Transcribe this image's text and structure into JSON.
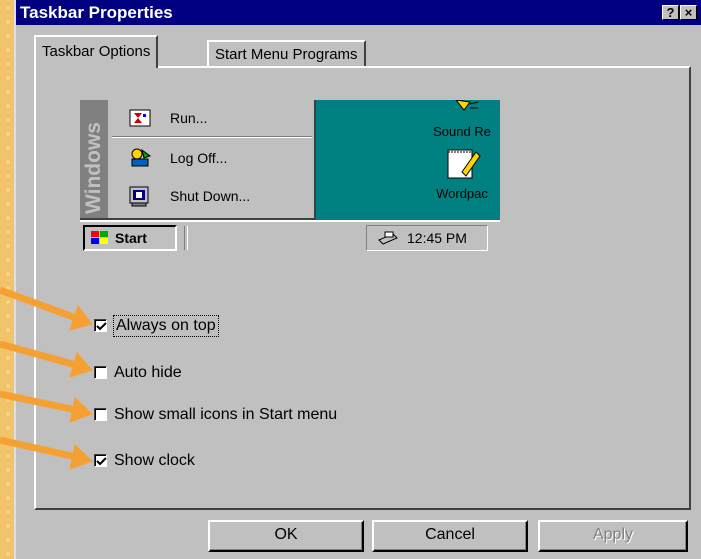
{
  "window": {
    "title": "Taskbar Properties",
    "help_label": "?",
    "close_label": "×"
  },
  "tabs": [
    {
      "label": "Taskbar Options",
      "active": true
    },
    {
      "label": "Start Menu Programs",
      "active": false
    }
  ],
  "preview": {
    "band_text": "Windows",
    "menu_items": [
      {
        "label": "Run...",
        "icon": "run-icon"
      },
      {
        "label": "Log Off...",
        "icon": "logoff-icon"
      },
      {
        "label": "Shut Down...",
        "icon": "shutdown-icon"
      }
    ],
    "desktop_icons": [
      {
        "label": "Sound Re",
        "icon": "sound-recorder-icon"
      },
      {
        "label": "Wordpac",
        "icon": "wordpad-icon"
      }
    ],
    "start_label": "Start",
    "clock": "12:45 PM"
  },
  "options": [
    {
      "label": "Always on top",
      "checked": true
    },
    {
      "label": "Auto hide",
      "checked": false
    },
    {
      "label": "Show small icons in Start menu",
      "checked": false
    },
    {
      "label": "Show clock",
      "checked": true
    }
  ],
  "buttons": {
    "ok": "OK",
    "cancel": "Cancel",
    "apply": "Apply"
  },
  "colors": {
    "title_bar": "#000080",
    "dialog": "#c0c0c0",
    "desktop": "#008080",
    "arrow": "#f5a033",
    "slide_bg": "#f2c46a"
  }
}
